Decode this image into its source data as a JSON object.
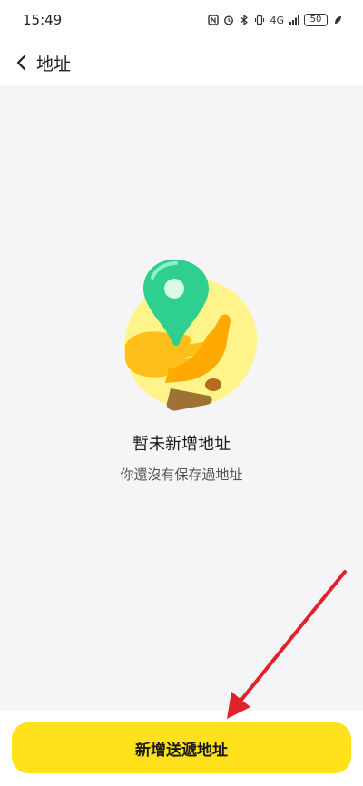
{
  "status_bar": {
    "time": "15:49",
    "network": "4G",
    "battery": "50",
    "icons": [
      "nfc-icon",
      "alarm-icon",
      "bluetooth-icon",
      "vibrate-icon",
      "signal-icon",
      "battery-icon",
      "leaf-icon"
    ]
  },
  "header": {
    "title": "地址",
    "back_icon": "chevron-left-icon"
  },
  "empty_state": {
    "title": "暫未新增地址",
    "subtitle": "你還沒有保存過地址",
    "illustration": "hand-holding-location-pin"
  },
  "footer": {
    "add_button_label": "新增送遞地址"
  },
  "colors": {
    "accent": "#ffe21c",
    "background": "#f5f5f8",
    "pin": "#2fcf8f",
    "annotation_arrow": "#e0232b"
  }
}
